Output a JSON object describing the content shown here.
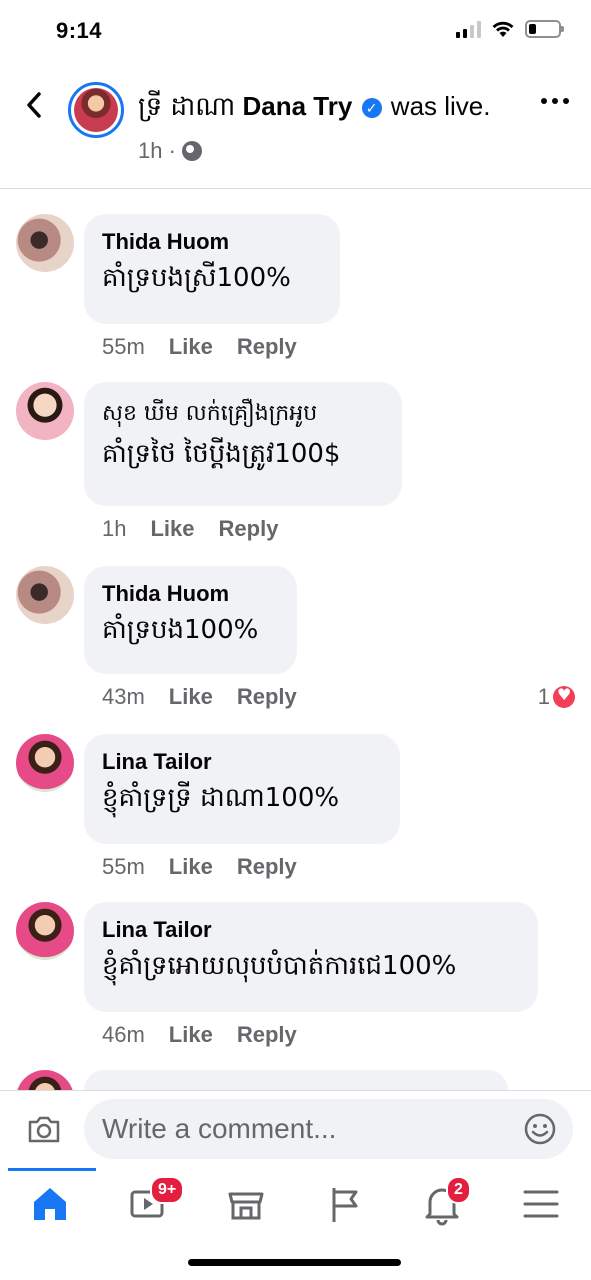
{
  "status": {
    "time": "9:14"
  },
  "header": {
    "name_khmer": "ទ្រី ដាណា",
    "name_latin": "Dana Try",
    "suffix": "was live.",
    "time": "1h ·"
  },
  "comments": [
    {
      "author": "Thida Huom",
      "text": "គាំទ្របងស្រី100%",
      "time": "55m",
      "like": "Like",
      "reply": "Reply"
    },
    {
      "author": "សុខ ឃីម លក់គ្រឿងក្រអូប",
      "text": "គាំទ្រថៃ ថៃប្តីងត្រូវ100$",
      "time": "1h",
      "like": "Like",
      "reply": "Reply"
    },
    {
      "author": "Thida Huom",
      "text": "គាំទ្របង100%",
      "time": "43m",
      "like": "Like",
      "reply": "Reply",
      "reactions": "1"
    },
    {
      "author": "Lina Tailor",
      "text": "ខ្ញុំគាំទ្រទ្រី ដាណា100%",
      "time": "55m",
      "like": "Like",
      "reply": "Reply"
    },
    {
      "author": "Lina Tailor",
      "text": "ខ្ញុំគាំទ្រអោយលុបបំបាត់ការជេ100%",
      "time": "46m",
      "like": "Like",
      "reply": "Reply"
    }
  ],
  "composer": {
    "placeholder": "Write a comment..."
  },
  "tabbar": {
    "watch_badge": "9+",
    "notifications_badge": "2"
  },
  "colors": {
    "accent": "#1877f2",
    "badge": "#e41e3f",
    "bubble": "#f0f2f5"
  }
}
